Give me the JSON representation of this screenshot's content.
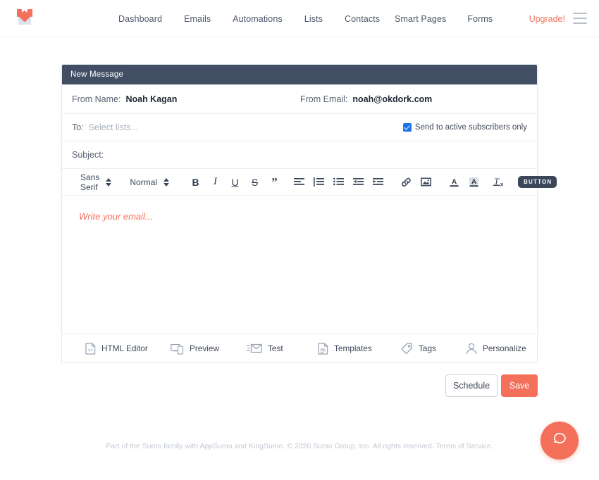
{
  "nav": {
    "logo_icon": "sumo-fox-logo",
    "links_left": [
      {
        "label": "Dashboard"
      },
      {
        "label": "Emails"
      },
      {
        "label": "Automations"
      },
      {
        "label": "Lists"
      },
      {
        "label": "Contacts"
      }
    ],
    "links_right": [
      {
        "label": "Smart Pages"
      },
      {
        "label": "Forms"
      }
    ],
    "upgrade_label": "Upgrade!",
    "upgrade_color": "#f4705a",
    "menu_icon": "hamburger-menu-icon"
  },
  "compose": {
    "header_title": "New Message",
    "header_bg": "#414e64",
    "from_name_label": "From Name:",
    "from_name_value": "Noah Kagan",
    "from_email_label": "From Email:",
    "from_email_value": "noah@okdork.com",
    "to_label": "To:",
    "to_placeholder": "Select lists...",
    "active_only_label": "Send to active subscribers only",
    "active_only_checked": true,
    "checkbox_color": "#1a73e8",
    "subject_label": "Subject:",
    "subject_value": "",
    "body_placeholder": "Write your email...",
    "body_placeholder_color": "#f4705a"
  },
  "toolbar": {
    "font_family": "Sans Serif",
    "font_size": "Normal",
    "buttons": [
      {
        "name": "bold-icon",
        "glyph": "B"
      },
      {
        "name": "italic-icon",
        "glyph": "I"
      },
      {
        "name": "underline-icon",
        "glyph": "U"
      },
      {
        "name": "strikethrough-icon",
        "glyph": "S"
      },
      {
        "name": "blockquote-icon",
        "glyph": "”"
      }
    ],
    "align_icon": "align-left-icon",
    "ordered_list_icon": "ordered-list-icon",
    "bullet_list_icon": "bullet-list-icon",
    "outdent_icon": "outdent-icon",
    "indent_icon": "indent-icon",
    "link_icon": "link-icon",
    "image_icon": "image-icon",
    "text_color_icon": "text-color-icon",
    "background_color_icon": "background-color-icon",
    "clear_format_icon": "clear-formatting-icon",
    "button_chip_label": "BUTTON"
  },
  "actions": [
    {
      "label": "HTML Editor",
      "icon": "html-editor-icon"
    },
    {
      "label": "Preview",
      "icon": "preview-icon"
    },
    {
      "label": "Test",
      "icon": "test-email-icon"
    },
    {
      "label": "Templates",
      "icon": "templates-icon"
    },
    {
      "label": "Tags",
      "icon": "tags-icon"
    },
    {
      "label": "Personalize",
      "icon": "personalize-icon"
    }
  ],
  "footer_buttons": {
    "schedule_label": "Schedule",
    "save_label": "Save",
    "save_color": "#f4705a"
  },
  "page_footer": {
    "text": "Part of the Sumo family with AppSumo and KingSumo. © 2020 Sumo Group, Inc.",
    "rights": "All rights reserved.",
    "terms": "Terms of Service."
  },
  "help": {
    "icon": "help-chat-bubble-icon",
    "color": "#f4705a"
  }
}
